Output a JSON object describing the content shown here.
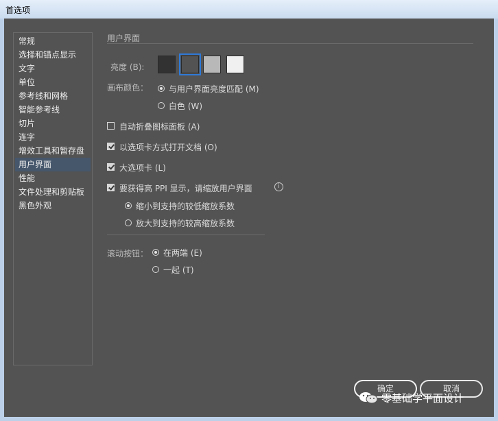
{
  "window": {
    "title": "首选项"
  },
  "sidebar": {
    "items": [
      {
        "label": "常规"
      },
      {
        "label": "选择和锚点显示"
      },
      {
        "label": "文字"
      },
      {
        "label": "单位"
      },
      {
        "label": "参考线和网格"
      },
      {
        "label": "智能参考线"
      },
      {
        "label": "切片"
      },
      {
        "label": "连字"
      },
      {
        "label": "增效工具和暂存盘"
      },
      {
        "label": "用户界面"
      },
      {
        "label": "性能"
      },
      {
        "label": "文件处理和剪贴板"
      },
      {
        "label": "黑色外观"
      }
    ],
    "selected": "用户界面"
  },
  "main": {
    "section_title": "用户界面",
    "brightness": {
      "label": "亮度 (B):",
      "swatch_colors": [
        "#323232",
        "#535353",
        "#b8b8b8",
        "#f0f0f0"
      ],
      "selected_index": 1
    },
    "canvas_color": {
      "label": "画布颜色：",
      "options": [
        {
          "label": "与用户界面亮度匹配 (M)",
          "checked": true
        },
        {
          "label": "白色 (W)",
          "checked": false
        }
      ]
    },
    "checkboxes": [
      {
        "label": "自动折叠图标面板 (A)",
        "checked": false
      },
      {
        "label": "以选项卡方式打开文档 (O)",
        "checked": true
      },
      {
        "label": "大选项卡 (L)",
        "checked": true
      },
      {
        "label": "要获得高 PPI 显示，请缩放用户界面",
        "checked": true
      }
    ],
    "info_icon": "info-icon",
    "scale_options": [
      {
        "label": "缩小到支持的较低缩放系数",
        "checked": true
      },
      {
        "label": "放大到支持的较高缩放系数",
        "checked": false
      }
    ],
    "scroll_buttons": {
      "label": "滚动按钮：",
      "options": [
        {
          "label": "在两端 (E)",
          "checked": true
        },
        {
          "label": "一起 (T)",
          "checked": false
        }
      ]
    }
  },
  "footer": {
    "ok_label": "确定",
    "cancel_label": "取消"
  },
  "watermark": {
    "text": "零基础学平面设计"
  }
}
